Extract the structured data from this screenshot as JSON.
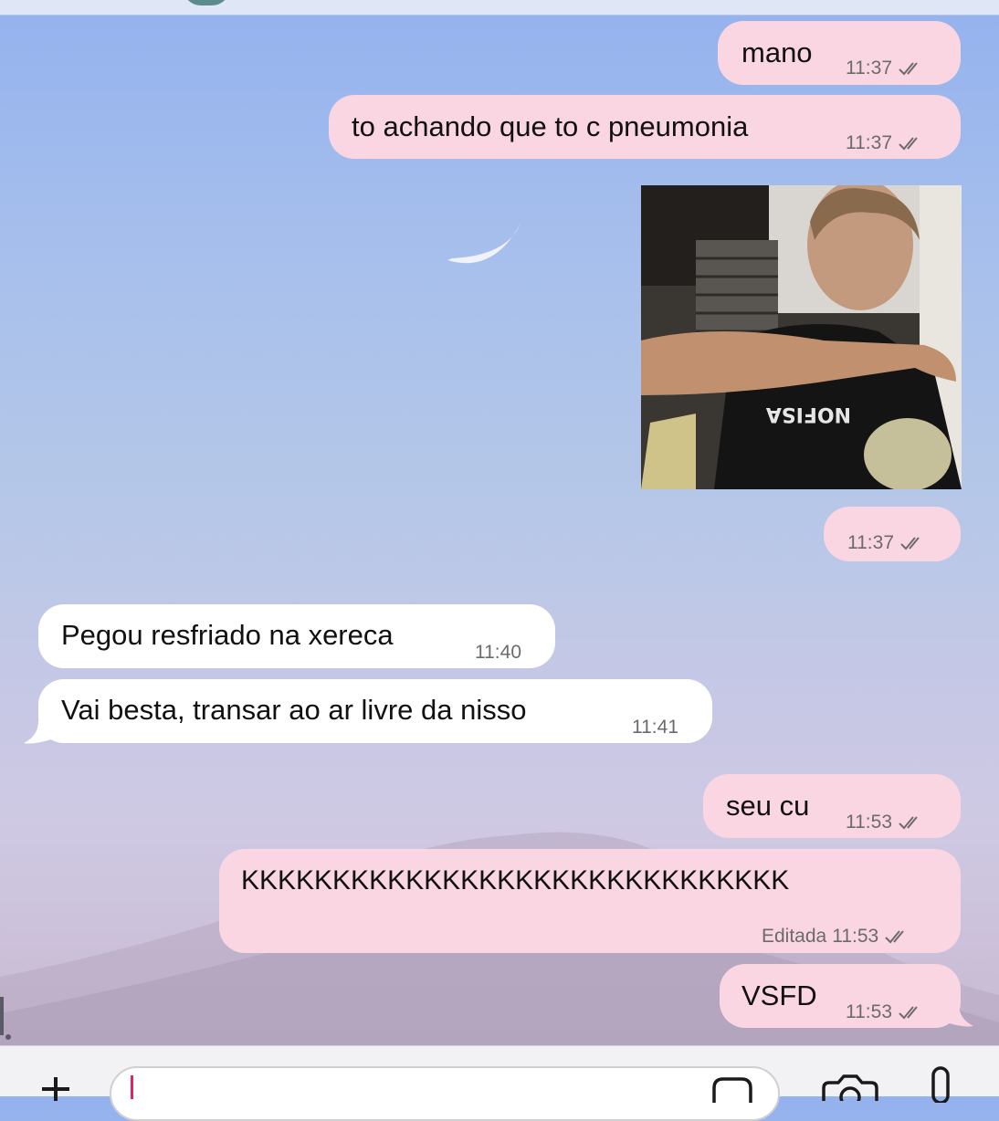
{
  "chat": {
    "messages": [
      {
        "direction": "out",
        "text": "mano",
        "time": "11:37",
        "status": "read"
      },
      {
        "direction": "out",
        "text": "to achando que to c pneumonia",
        "time": "11:37",
        "status": "read"
      },
      {
        "direction": "out",
        "type": "image",
        "time": "11:37",
        "status": "read"
      },
      {
        "direction": "in",
        "text": "Pegou resfriado na xereca",
        "time": "11:40"
      },
      {
        "direction": "in",
        "text": "Vai besta, transar ao ar livre da nisso",
        "time": "11:41"
      },
      {
        "direction": "out",
        "text": "seu cu",
        "time": "11:53",
        "status": "read"
      },
      {
        "direction": "out",
        "text": "KKKKKKKKKKKKKKKKKKKKKKKKKKKKKK",
        "time": "11:53",
        "edited_label": "Editada",
        "status": "read"
      },
      {
        "direction": "out",
        "text": "VSFD",
        "time": "11:53",
        "status": "read"
      }
    ]
  },
  "composer": {
    "icons": [
      "plus-icon",
      "sticker-icon",
      "camera-icon",
      "mic-icon"
    ]
  },
  "colors": {
    "outgoing_bubble": "#fad5e2",
    "incoming_bubble": "#ffffff",
    "caret": "#e0245e"
  }
}
